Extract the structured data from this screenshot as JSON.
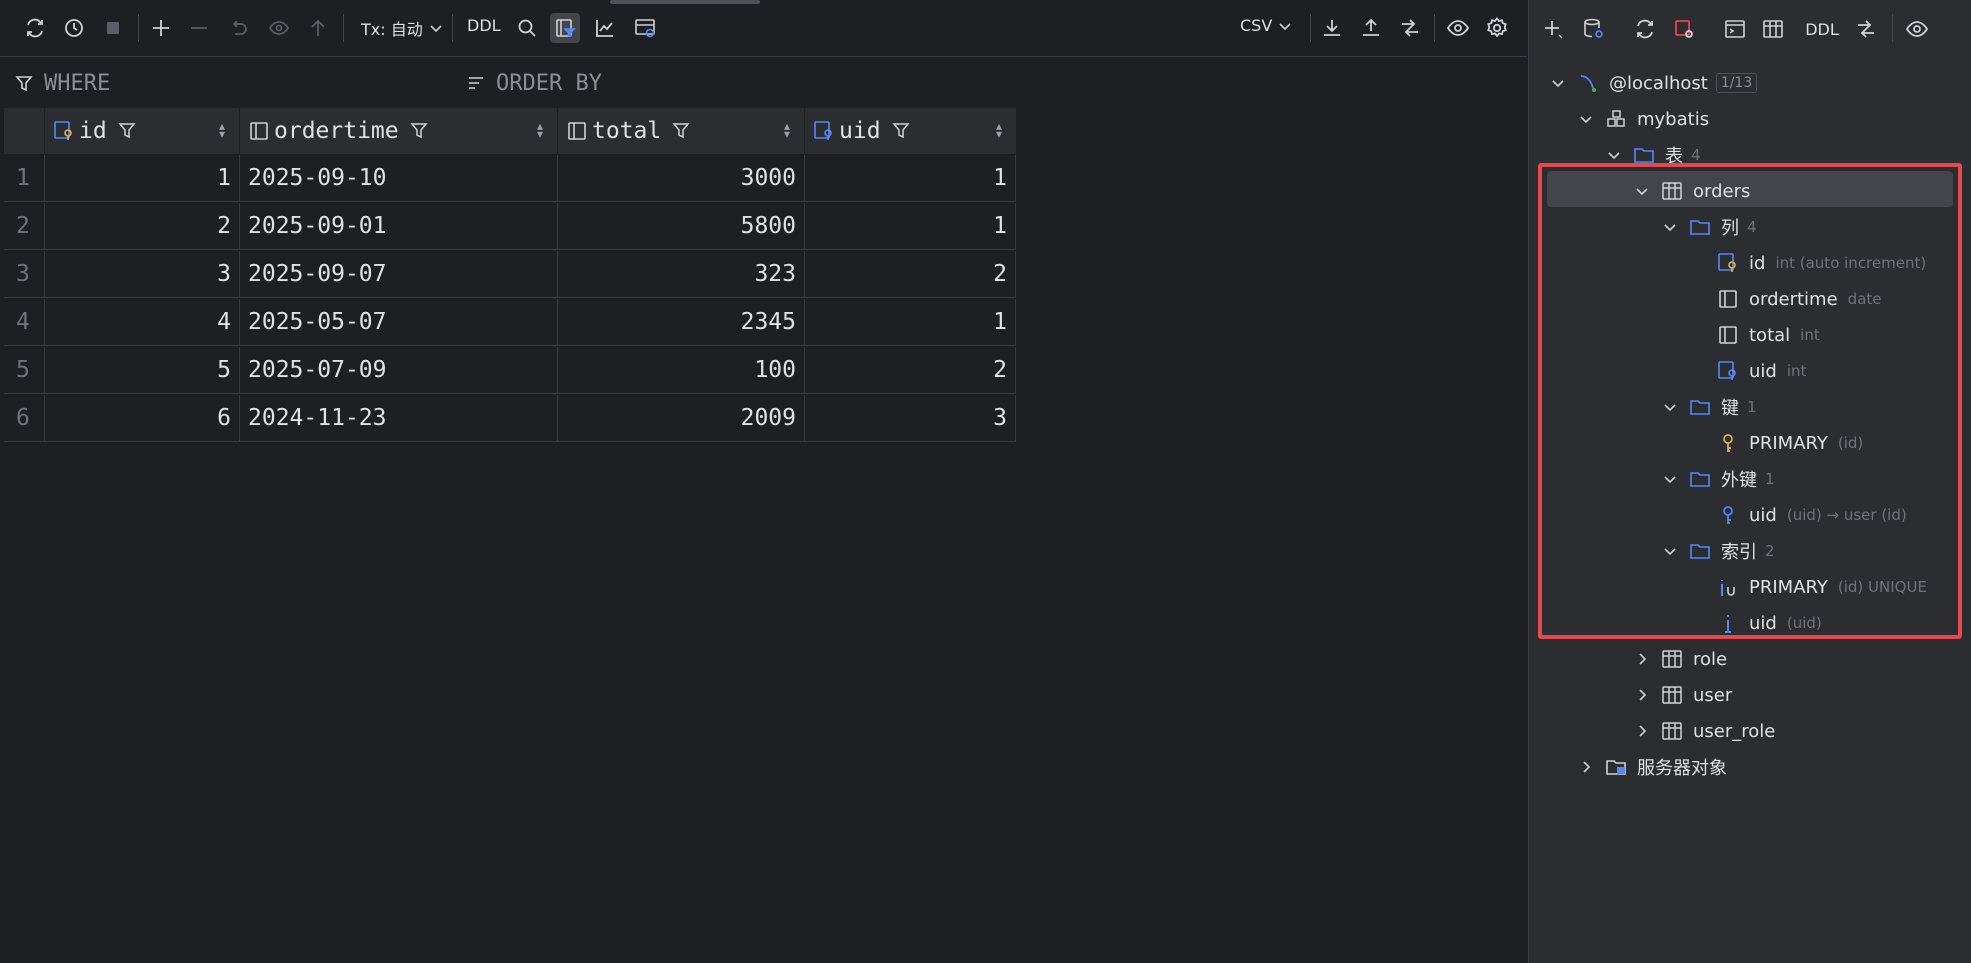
{
  "toolbar": {
    "tx_label": "Tx: 自动",
    "ddl_label": "DDL",
    "export_format": "CSV"
  },
  "filterbar": {
    "where_label": "WHERE",
    "order_label": "ORDER BY"
  },
  "grid": {
    "columns": [
      "id",
      "ordertime",
      "total",
      "uid"
    ],
    "rows": [
      {
        "n": "1",
        "id": "1",
        "ordertime": "2025-09-10",
        "total": "3000",
        "uid": "1"
      },
      {
        "n": "2",
        "id": "2",
        "ordertime": "2025-09-01",
        "total": "5800",
        "uid": "1"
      },
      {
        "n": "3",
        "id": "3",
        "ordertime": "2025-09-07",
        "total": "323",
        "uid": "2"
      },
      {
        "n": "4",
        "id": "4",
        "ordertime": "2025-05-07",
        "total": "2345",
        "uid": "1"
      },
      {
        "n": "5",
        "id": "5",
        "ordertime": "2025-07-09",
        "total": "100",
        "uid": "2"
      },
      {
        "n": "6",
        "id": "6",
        "ordertime": "2024-11-23",
        "total": "2009",
        "uid": "3"
      }
    ]
  },
  "rtoolbar": {
    "ddl_label": "DDL"
  },
  "tree": {
    "host": "@localhost",
    "host_badge": "1/13",
    "schema": "mybatis",
    "tables_folder": "表",
    "tables_count": "4",
    "orders": "orders",
    "cols_folder": "列",
    "cols_count": "4",
    "col_id": "id",
    "col_id_type": "int (auto increment)",
    "col_ordertime": "ordertime",
    "col_ordertime_type": "date",
    "col_total": "total",
    "col_total_type": "int",
    "col_uid": "uid",
    "col_uid_type": "int",
    "keys_folder": "键",
    "keys_count": "1",
    "key_primary": "PRIMARY",
    "key_primary_sub": "(id)",
    "fk_folder": "外键",
    "fk_count": "1",
    "fk_uid": "uid",
    "fk_uid_sub": "(uid) → user (id)",
    "idx_folder": "索引",
    "idx_count": "2",
    "idx_primary": "PRIMARY",
    "idx_primary_sub": "(id) UNIQUE",
    "idx_uid": "uid",
    "idx_uid_sub": "(uid)",
    "t_role": "role",
    "t_user": "user",
    "t_user_role": "user_role",
    "server_objects": "服务器对象"
  },
  "colors": {
    "highlight": "#e5484d",
    "folder_blue": "#548af7",
    "key_yellow": "#e6b450"
  }
}
